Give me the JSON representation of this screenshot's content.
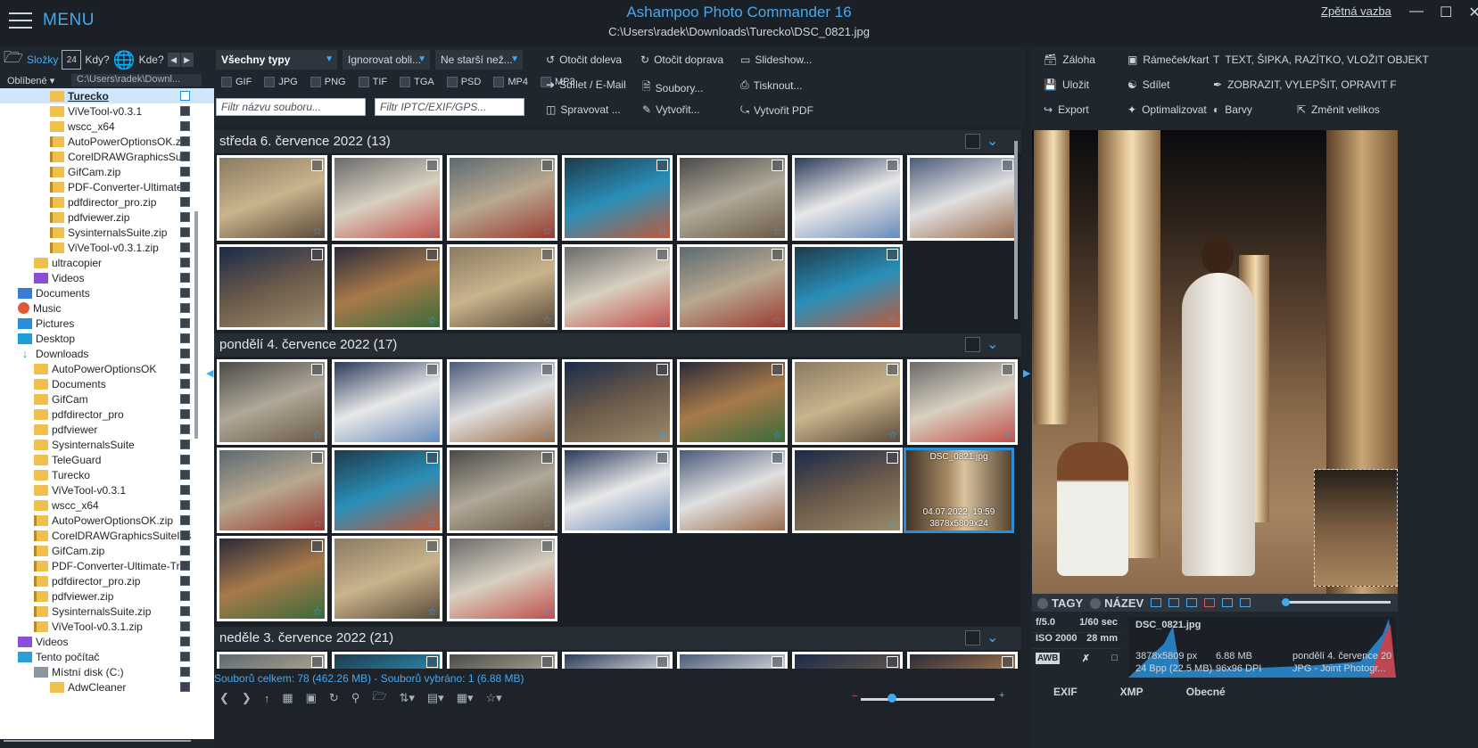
{
  "titlebar": {
    "menu_label": "MENU",
    "app_title": "Ashampoo Photo Commander 16",
    "path": "C:\\Users\\radek\\Downloads\\Turecko\\DSC_0821.jpg",
    "feedback": "Zpětná vazba"
  },
  "left": {
    "tabs": {
      "folders": "Složky",
      "when": "Kdy?",
      "where": "Kde?",
      "calendar_day": "24"
    },
    "favorites": "Oblíbené",
    "path": "C:\\Users\\radek\\Downl...",
    "tree": [
      {
        "label": "Turecko",
        "icon": "folder",
        "indent": 56,
        "sel": true,
        "chk": "on"
      },
      {
        "label": "ViVeTool-v0.3.1",
        "icon": "folder",
        "indent": 56,
        "chk": "off"
      },
      {
        "label": "wscc_x64",
        "icon": "folder",
        "indent": 56,
        "chk": "off"
      },
      {
        "label": "AutoPowerOptionsOK.zi",
        "icon": "zip",
        "indent": 56,
        "chk": "off"
      },
      {
        "label": "CorelDRAWGraphicsSuit",
        "icon": "zip",
        "indent": 56,
        "chk": "off"
      },
      {
        "label": "GifCam.zip",
        "icon": "zip",
        "indent": 56,
        "chk": "off"
      },
      {
        "label": "PDF-Converter-Ultimate",
        "icon": "zip",
        "indent": 56,
        "chk": "off"
      },
      {
        "label": "pdfdirector_pro.zip",
        "icon": "zip",
        "indent": 56,
        "chk": "off"
      },
      {
        "label": "pdfviewer.zip",
        "icon": "zip",
        "indent": 56,
        "chk": "off"
      },
      {
        "label": "SysinternalsSuite.zip",
        "icon": "zip",
        "indent": 56,
        "chk": "off"
      },
      {
        "label": "ViVeTool-v0.3.1.zip",
        "icon": "zip",
        "indent": 56,
        "chk": "off"
      },
      {
        "label": "ultracopier",
        "icon": "folder",
        "indent": 38,
        "chk": "off"
      },
      {
        "label": "Videos",
        "icon": "vid",
        "indent": 38,
        "chk": "off"
      },
      {
        "label": "Documents",
        "icon": "doc",
        "indent": 20,
        "chk": "off"
      },
      {
        "label": "Music",
        "icon": "music",
        "indent": 20,
        "chk": "off"
      },
      {
        "label": "Pictures",
        "icon": "pic",
        "indent": 20,
        "chk": "off"
      },
      {
        "label": "Desktop",
        "icon": "desk",
        "indent": 20,
        "chk": "off"
      },
      {
        "label": "Downloads",
        "icon": "dl",
        "indent": 20,
        "chk": "off"
      },
      {
        "label": "AutoPowerOptionsOK",
        "icon": "folder",
        "indent": 38,
        "chk": "off"
      },
      {
        "label": "Documents",
        "icon": "folder",
        "indent": 38,
        "chk": "off"
      },
      {
        "label": "GifCam",
        "icon": "folder",
        "indent": 38,
        "chk": "off"
      },
      {
        "label": "pdfdirector_pro",
        "icon": "folder",
        "indent": 38,
        "chk": "off"
      },
      {
        "label": "pdfviewer",
        "icon": "folder",
        "indent": 38,
        "chk": "off"
      },
      {
        "label": "SysinternalsSuite",
        "icon": "folder",
        "indent": 38,
        "chk": "off"
      },
      {
        "label": "TeleGuard",
        "icon": "folder",
        "indent": 38,
        "chk": "off"
      },
      {
        "label": "Turecko",
        "icon": "folder",
        "indent": 38,
        "chk": "off"
      },
      {
        "label": "ViVeTool-v0.3.1",
        "icon": "folder",
        "indent": 38,
        "chk": "off"
      },
      {
        "label": "wscc_x64",
        "icon": "folder",
        "indent": 38,
        "chk": "off"
      },
      {
        "label": "AutoPowerOptionsOK.zip",
        "icon": "zip",
        "indent": 38,
        "chk": "off"
      },
      {
        "label": "CorelDRAWGraphicsSuiteIns",
        "icon": "zip",
        "indent": 38,
        "chk": "off"
      },
      {
        "label": "GifCam.zip",
        "icon": "zip",
        "indent": 38,
        "chk": "off"
      },
      {
        "label": "PDF-Converter-Ultimate-Tri",
        "icon": "zip",
        "indent": 38,
        "chk": "off"
      },
      {
        "label": "pdfdirector_pro.zip",
        "icon": "zip",
        "indent": 38,
        "chk": "off"
      },
      {
        "label": "pdfviewer.zip",
        "icon": "zip",
        "indent": 38,
        "chk": "off"
      },
      {
        "label": "SysinternalsSuite.zip",
        "icon": "zip",
        "indent": 38,
        "chk": "off"
      },
      {
        "label": "ViVeTool-v0.3.1.zip",
        "icon": "zip",
        "indent": 38,
        "chk": "off"
      },
      {
        "label": "Videos",
        "icon": "vid",
        "indent": 20,
        "chk": "off"
      },
      {
        "label": "Tento počítač",
        "icon": "pc",
        "indent": 20,
        "chk": "off"
      },
      {
        "label": "Místní disk (C:)",
        "icon": "disk",
        "indent": 38,
        "chk": "off"
      },
      {
        "label": "AdwCleaner",
        "icon": "folder",
        "indent": 56,
        "chk": "off"
      }
    ]
  },
  "toolbar": {
    "type_select": "Všechny typy",
    "ignore_select": "Ignorovat obli...",
    "age_select": "Ne starší než...",
    "types": [
      "GIF",
      "JPG",
      "PNG",
      "TIF",
      "TGA",
      "PSD",
      "MP4",
      "MP3"
    ],
    "filename_placeholder": "Filtr názvu souboru...",
    "iptc_placeholder": "Filtr IPTC/EXIF/GPS...",
    "rotate_left": "Otočit doleva",
    "rotate_right": "Otočit doprava",
    "slideshow": "Slideshow...",
    "share_email": "Sdílet / E-Mail",
    "files": "Soubory...",
    "print": "Tisknout...",
    "manage": "Spravovat ...",
    "create": "Vytvořit...",
    "create_pdf": "Vytvořit PDF"
  },
  "groups": [
    {
      "title": "středa 6. července 2022 (13)"
    },
    {
      "title": "pondělí 4. července 2022 (17)"
    },
    {
      "title": "neděle 3. července 2022 (21)"
    }
  ],
  "selected_thumb": {
    "name": "DSC_0821.jpg",
    "date": "04.07.2022, 19:59",
    "dims": "3878x5809x24"
  },
  "status": {
    "summary": "Souborů celkem: 78 (462.26 MB) - Souborů vybráno: 1 (6.88 MB)"
  },
  "right": {
    "backup": "Záloha",
    "frame": "Rámeček/kart",
    "text_tools": "TEXT, ŠIPKA, RAZÍTKO, VLOŽIT OBJEKT",
    "save": "Uložit",
    "share": "Sdílet",
    "enhance": "ZOBRAZIT, VYLEPŠIT, OPRAVIT FOTOGR...",
    "export": "Export",
    "optimize": "Optimalizovat",
    "colors": "Barvy",
    "resize": "Změnit velikos"
  },
  "preview_bar": {
    "tags": "TAGY",
    "name": "NÁZEV"
  },
  "exif": {
    "aperture": "f/5.0",
    "shutter": "1/60 sec",
    "iso": "ISO 2000",
    "focal": "28 mm",
    "filename": "DSC_0821.jpg",
    "dims": "3878x5809 px",
    "size": "6.88 MB",
    "date": "pondělí 4. července 20",
    "bpp": "24 Bpp (22.5 MB)",
    "dpi": "96x96 DPI",
    "format": "JPG - Joint Photogr...",
    "awb": "AWB"
  },
  "rtabs": {
    "exif": "EXIF",
    "xmp": "XMP",
    "general": "Obecné"
  }
}
